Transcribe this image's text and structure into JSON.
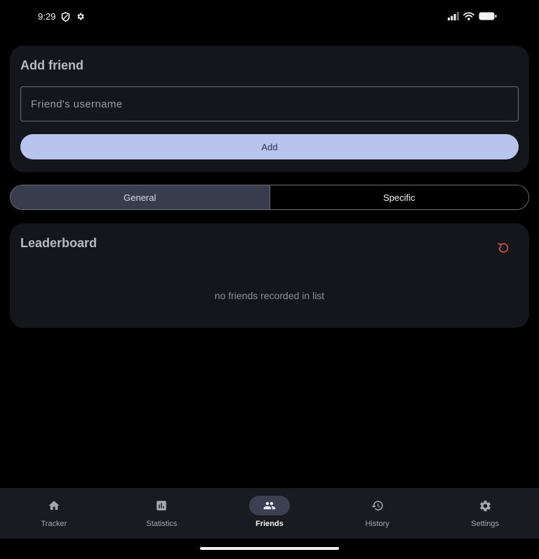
{
  "status_bar": {
    "time": "9:29",
    "icons": [
      "shield-icon",
      "gear-icon",
      "cellular-signal-icon",
      "wifi-icon",
      "battery-icon"
    ]
  },
  "add_friend": {
    "title": "Add friend",
    "username_placeholder": "Friend's username",
    "username_value": "",
    "add_label": "Add"
  },
  "segments": {
    "general_label": "General",
    "specific_label": "Specific",
    "selected": "General"
  },
  "leaderboard": {
    "title": "Leaderboard",
    "refresh_icon": "refresh-icon",
    "empty_message": "no friends recorded in list"
  },
  "bottom_nav": {
    "items": [
      {
        "label": "Tracker",
        "icon": "home-icon"
      },
      {
        "label": "Statistics",
        "icon": "bar-chart-icon"
      },
      {
        "label": "Friends",
        "icon": "people-icon"
      },
      {
        "label": "History",
        "icon": "history-icon"
      },
      {
        "label": "Settings",
        "icon": "gear-icon"
      }
    ],
    "active": "Friends"
  },
  "colors": {
    "background": "#000000",
    "card": "#15161b",
    "accent": "#b8c3ee",
    "segment_selected": "#393c4c",
    "refresh": "#c0524d",
    "nav_bar": "#1a1b20"
  }
}
